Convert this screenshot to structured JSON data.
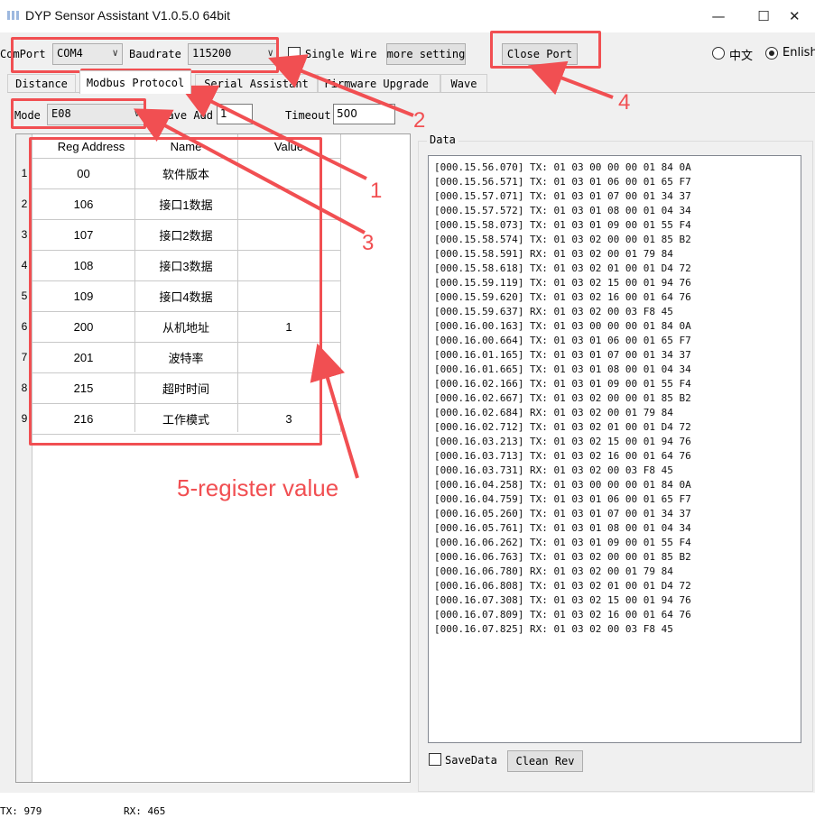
{
  "window": {
    "title": "DYP Sensor Assistant V1.0.5.0 64bit",
    "minimize_glyph": "—",
    "maximize_glyph": "☐",
    "close_glyph": "✕"
  },
  "toolbar": {
    "comport_label": "ComPort",
    "comport_value": "COM4",
    "baudrate_label": "Baudrate",
    "baudrate_value": "115200",
    "single_wire_label": "Single Wire",
    "more_setting_label": "more setting",
    "close_port_label": "Close Port",
    "lang_zh_label": "中文",
    "lang_en_label": "Enlish",
    "dropdown_glyph": "∨"
  },
  "tabs": [
    {
      "label": "Distance"
    },
    {
      "label": "Modbus Protocol"
    },
    {
      "label": "Serial Assistant"
    },
    {
      "label": "Firmware Upgrade"
    },
    {
      "label": "Wave"
    }
  ],
  "modbus": {
    "mode_label": "Mode",
    "mode_value": "E08",
    "slave_label": "Slave Add",
    "slave_value": "1",
    "timeout_label": "Timeout",
    "timeout_value": "500"
  },
  "grid": {
    "columns": [
      "Reg Address",
      "Name",
      "Value"
    ],
    "rows": [
      {
        "index": "1",
        "address": "00",
        "name": "软件版本",
        "value": ""
      },
      {
        "index": "2",
        "address": "106",
        "name": "接口1数据",
        "value": ""
      },
      {
        "index": "3",
        "address": "107",
        "name": "接口2数据",
        "value": ""
      },
      {
        "index": "4",
        "address": "108",
        "name": "接口3数据",
        "value": ""
      },
      {
        "index": "5",
        "address": "109",
        "name": "接口4数据",
        "value": ""
      },
      {
        "index": "6",
        "address": "200",
        "name": "从机地址",
        "value": "1"
      },
      {
        "index": "7",
        "address": "201",
        "name": "波特率",
        "value": ""
      },
      {
        "index": "8",
        "address": "215",
        "name": "超时时间",
        "value": ""
      },
      {
        "index": "9",
        "address": "216",
        "name": "工作模式",
        "value": "3"
      }
    ]
  },
  "data_panel": {
    "legend": "Data",
    "log": [
      "[000.15.56.070] TX: 01 03 00 00 00 01 84 0A",
      "[000.15.56.571] TX: 01 03 01 06 00 01 65 F7",
      "[000.15.57.071] TX: 01 03 01 07 00 01 34 37",
      "[000.15.57.572] TX: 01 03 01 08 00 01 04 34",
      "[000.15.58.073] TX: 01 03 01 09 00 01 55 F4",
      "[000.15.58.574] TX: 01 03 02 00 00 01 85 B2",
      "[000.15.58.591] RX: 01 03 02 00 01 79 84",
      "[000.15.58.618] TX: 01 03 02 01 00 01 D4 72",
      "[000.15.59.119] TX: 01 03 02 15 00 01 94 76",
      "[000.15.59.620] TX: 01 03 02 16 00 01 64 76",
      "[000.15.59.637] RX: 01 03 02 00 03 F8 45",
      "[000.16.00.163] TX: 01 03 00 00 00 01 84 0A",
      "[000.16.00.664] TX: 01 03 01 06 00 01 65 F7",
      "[000.16.01.165] TX: 01 03 01 07 00 01 34 37",
      "[000.16.01.665] TX: 01 03 01 08 00 01 04 34",
      "[000.16.02.166] TX: 01 03 01 09 00 01 55 F4",
      "[000.16.02.667] TX: 01 03 02 00 00 01 85 B2",
      "[000.16.02.684] RX: 01 03 02 00 01 79 84",
      "[000.16.02.712] TX: 01 03 02 01 00 01 D4 72",
      "[000.16.03.213] TX: 01 03 02 15 00 01 94 76",
      "[000.16.03.713] TX: 01 03 02 16 00 01 64 76",
      "[000.16.03.731] RX: 01 03 02 00 03 F8 45",
      "[000.16.04.258] TX: 01 03 00 00 00 01 84 0A",
      "[000.16.04.759] TX: 01 03 01 06 00 01 65 F7",
      "[000.16.05.260] TX: 01 03 01 07 00 01 34 37",
      "[000.16.05.761] TX: 01 03 01 08 00 01 04 34",
      "[000.16.06.262] TX: 01 03 01 09 00 01 55 F4",
      "[000.16.06.763] TX: 01 03 02 00 00 01 85 B2",
      "[000.16.06.780] RX: 01 03 02 00 01 79 84",
      "[000.16.06.808] TX: 01 03 02 01 00 01 D4 72",
      "[000.16.07.308] TX: 01 03 02 15 00 01 94 76",
      "[000.16.07.809] TX: 01 03 02 16 00 01 64 76",
      "[000.16.07.825] RX: 01 03 02 00 03 F8 45"
    ],
    "save_data_label": "SaveData",
    "clean_rev_label": "Clean Rev"
  },
  "status": {
    "tx_label": "TX: 979",
    "rx_label": "RX: 465"
  },
  "annotations": {
    "color": "#f14f52",
    "labels": [
      "1",
      "2",
      "3",
      "4",
      "5-register value"
    ]
  }
}
